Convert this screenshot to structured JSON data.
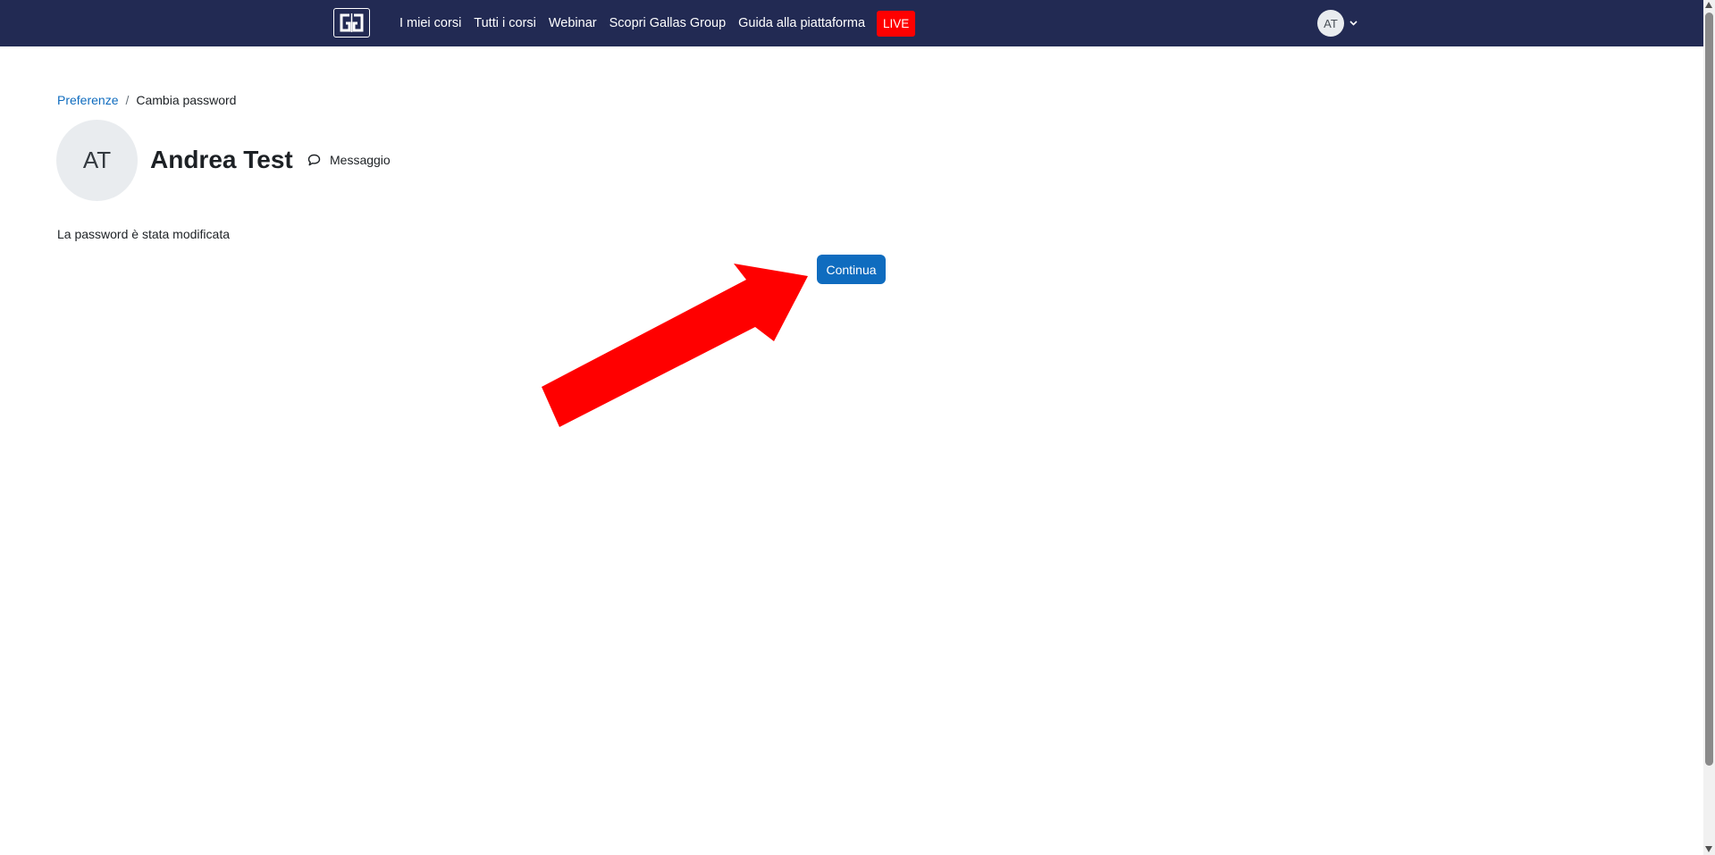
{
  "navbar": {
    "items": [
      {
        "label": "I miei corsi"
      },
      {
        "label": "Tutti i corsi"
      },
      {
        "label": "Webinar"
      },
      {
        "label": "Scopri Gallas Group"
      },
      {
        "label": "Guida alla piattaforma"
      }
    ],
    "live_label": "LIVE",
    "user_initials": "AT",
    "brand_icon": "gg-logo-icon",
    "caret_icon": "chevron-down-icon"
  },
  "breadcrumb": {
    "parent": "Preferenze",
    "separator": "/",
    "current": "Cambia password"
  },
  "profile": {
    "initials": "AT",
    "name": "Andrea Test",
    "message_label": "Messaggio",
    "message_icon": "chat-bubble-icon"
  },
  "main": {
    "notice": "La password è stata modificata",
    "continue_label": "Continua"
  },
  "colors": {
    "navbar_bg": "#222a53",
    "live_bg": "#ff0000",
    "link": "#0f6cbf",
    "button_bg": "#0f6cbf",
    "annotation_arrow": "#ff0000"
  }
}
